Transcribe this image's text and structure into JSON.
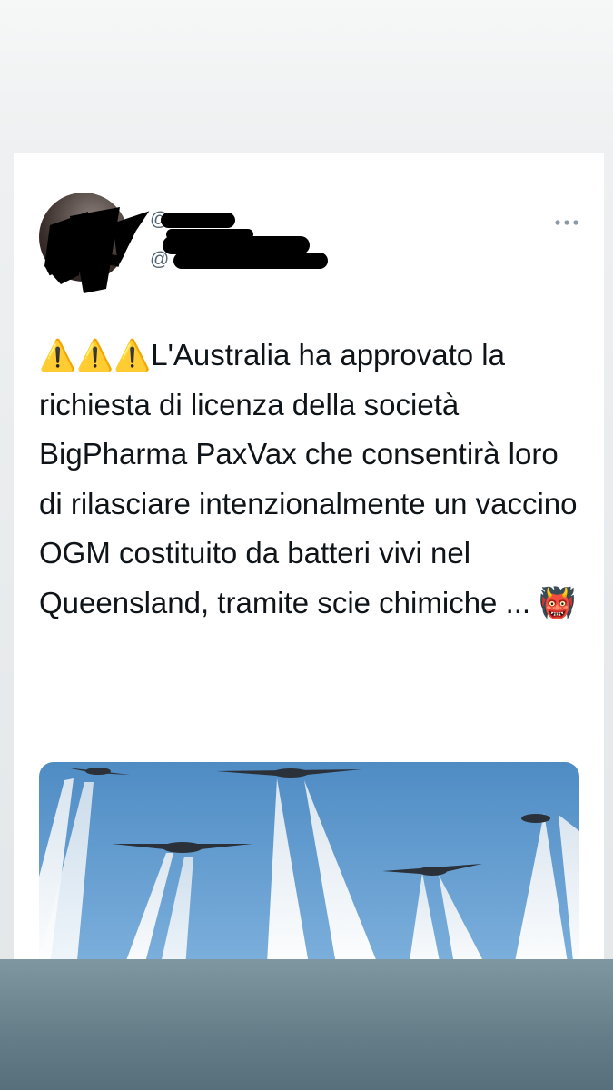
{
  "tweet": {
    "handle_prefix": "@",
    "handle_prefix_2": "@",
    "text": "⚠️⚠️⚠️L'Australia ha approvato la richiesta di licenza della società BigPharma PaxVax che consentirà loro di rilasciare intenzionalmente un vaccino OGM costituito da batteri vivi nel Queensland, tramite scie chimiche ... 👹",
    "more_icon": "more-horizontal-icon",
    "media_icon": "image"
  },
  "colors": {
    "text": "#0f1419",
    "secondary": "#536471",
    "sky": "#5f95c4"
  }
}
